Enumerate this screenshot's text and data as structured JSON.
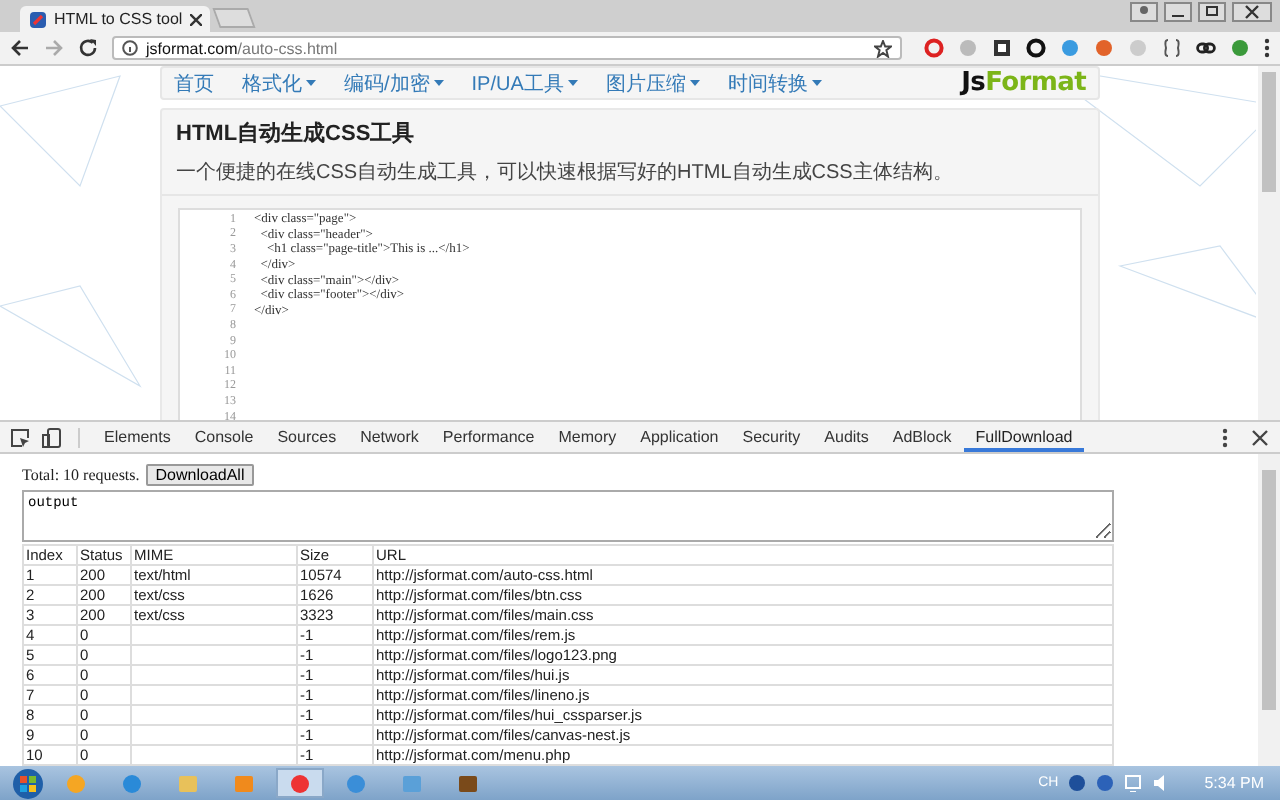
{
  "browser": {
    "tab_title": "HTML to CSS tool",
    "url_host": "jsformat.com",
    "url_path": "/auto-css.html"
  },
  "site": {
    "nav": [
      {
        "label": "首页",
        "has_menu": false
      },
      {
        "label": "格式化",
        "has_menu": true
      },
      {
        "label": "编码/加密",
        "has_menu": true
      },
      {
        "label": "IP/UA工具",
        "has_menu": true
      },
      {
        "label": "图片压缩",
        "has_menu": true
      },
      {
        "label": "时间转换",
        "has_menu": true
      }
    ],
    "logo": [
      "Js",
      "Format"
    ],
    "heading": "HTML自动生成CSS工具",
    "description": "一个便捷的在线CSS自动生成工具，可以快速根据写好的HTML自动生成CSS主体结构。",
    "editor_lines": [
      {
        "number": "1",
        "code": "<div class=\"page\">"
      },
      {
        "number": "2",
        "code": "  <div class=\"header\">"
      },
      {
        "number": "3",
        "code": "    <h1 class=\"page-title\">This is ...</h1>"
      },
      {
        "number": "4",
        "code": "  </div>"
      },
      {
        "number": "5",
        "code": "  <div class=\"main\"></div>"
      },
      {
        "number": "6",
        "code": "  <div class=\"footer\"></div>"
      },
      {
        "number": "7",
        "code": "</div>"
      },
      {
        "number": "8"
      },
      {
        "number": "9"
      },
      {
        "number": "10"
      },
      {
        "number": "11"
      },
      {
        "number": "12"
      },
      {
        "number": "13"
      },
      {
        "number": "14"
      }
    ]
  },
  "devtools": {
    "tabs": [
      {
        "label": "Elements",
        "selected": false
      },
      {
        "label": "Console",
        "selected": false
      },
      {
        "label": "Sources",
        "selected": false
      },
      {
        "label": "Network",
        "selected": false
      },
      {
        "label": "Performance",
        "selected": false
      },
      {
        "label": "Memory",
        "selected": false
      },
      {
        "label": "Application",
        "selected": false
      },
      {
        "label": "Security",
        "selected": false
      },
      {
        "label": "Audits",
        "selected": false
      },
      {
        "label": "AdBlock",
        "selected": false
      },
      {
        "label": "FullDownload",
        "selected": true
      }
    ],
    "summary": "Total: 10 requests.",
    "download_button": "DownloadAll",
    "output": "output",
    "table": {
      "columns": [
        "Index",
        "Status",
        "MIME",
        "Size",
        "URL"
      ],
      "rows": [
        [
          "1",
          "200",
          "text/html",
          "10574",
          "http://jsformat.com/auto-css.html"
        ],
        [
          "2",
          "200",
          "text/css",
          "1626",
          "http://jsformat.com/files/btn.css"
        ],
        [
          "3",
          "200",
          "text/css",
          "3323",
          "http://jsformat.com/files/main.css"
        ],
        [
          "4",
          "0",
          "",
          "-1",
          "http://jsformat.com/files/rem.js"
        ],
        [
          "5",
          "0",
          "",
          "-1",
          "http://jsformat.com/files/logo123.png"
        ],
        [
          "6",
          "0",
          "",
          "-1",
          "http://jsformat.com/files/hui.js"
        ],
        [
          "7",
          "0",
          "",
          "-1",
          "http://jsformat.com/files/lineno.js"
        ],
        [
          "8",
          "0",
          "",
          "-1",
          "http://jsformat.com/files/hui_cssparser.js"
        ],
        [
          "9",
          "0",
          "",
          "-1",
          "http://jsformat.com/files/canvas-nest.js"
        ],
        [
          "10",
          "0",
          "",
          "-1",
          "http://jsformat.com/menu.php"
        ]
      ]
    }
  },
  "taskbar": {
    "language": "CH",
    "clock": "5:34 PM"
  }
}
